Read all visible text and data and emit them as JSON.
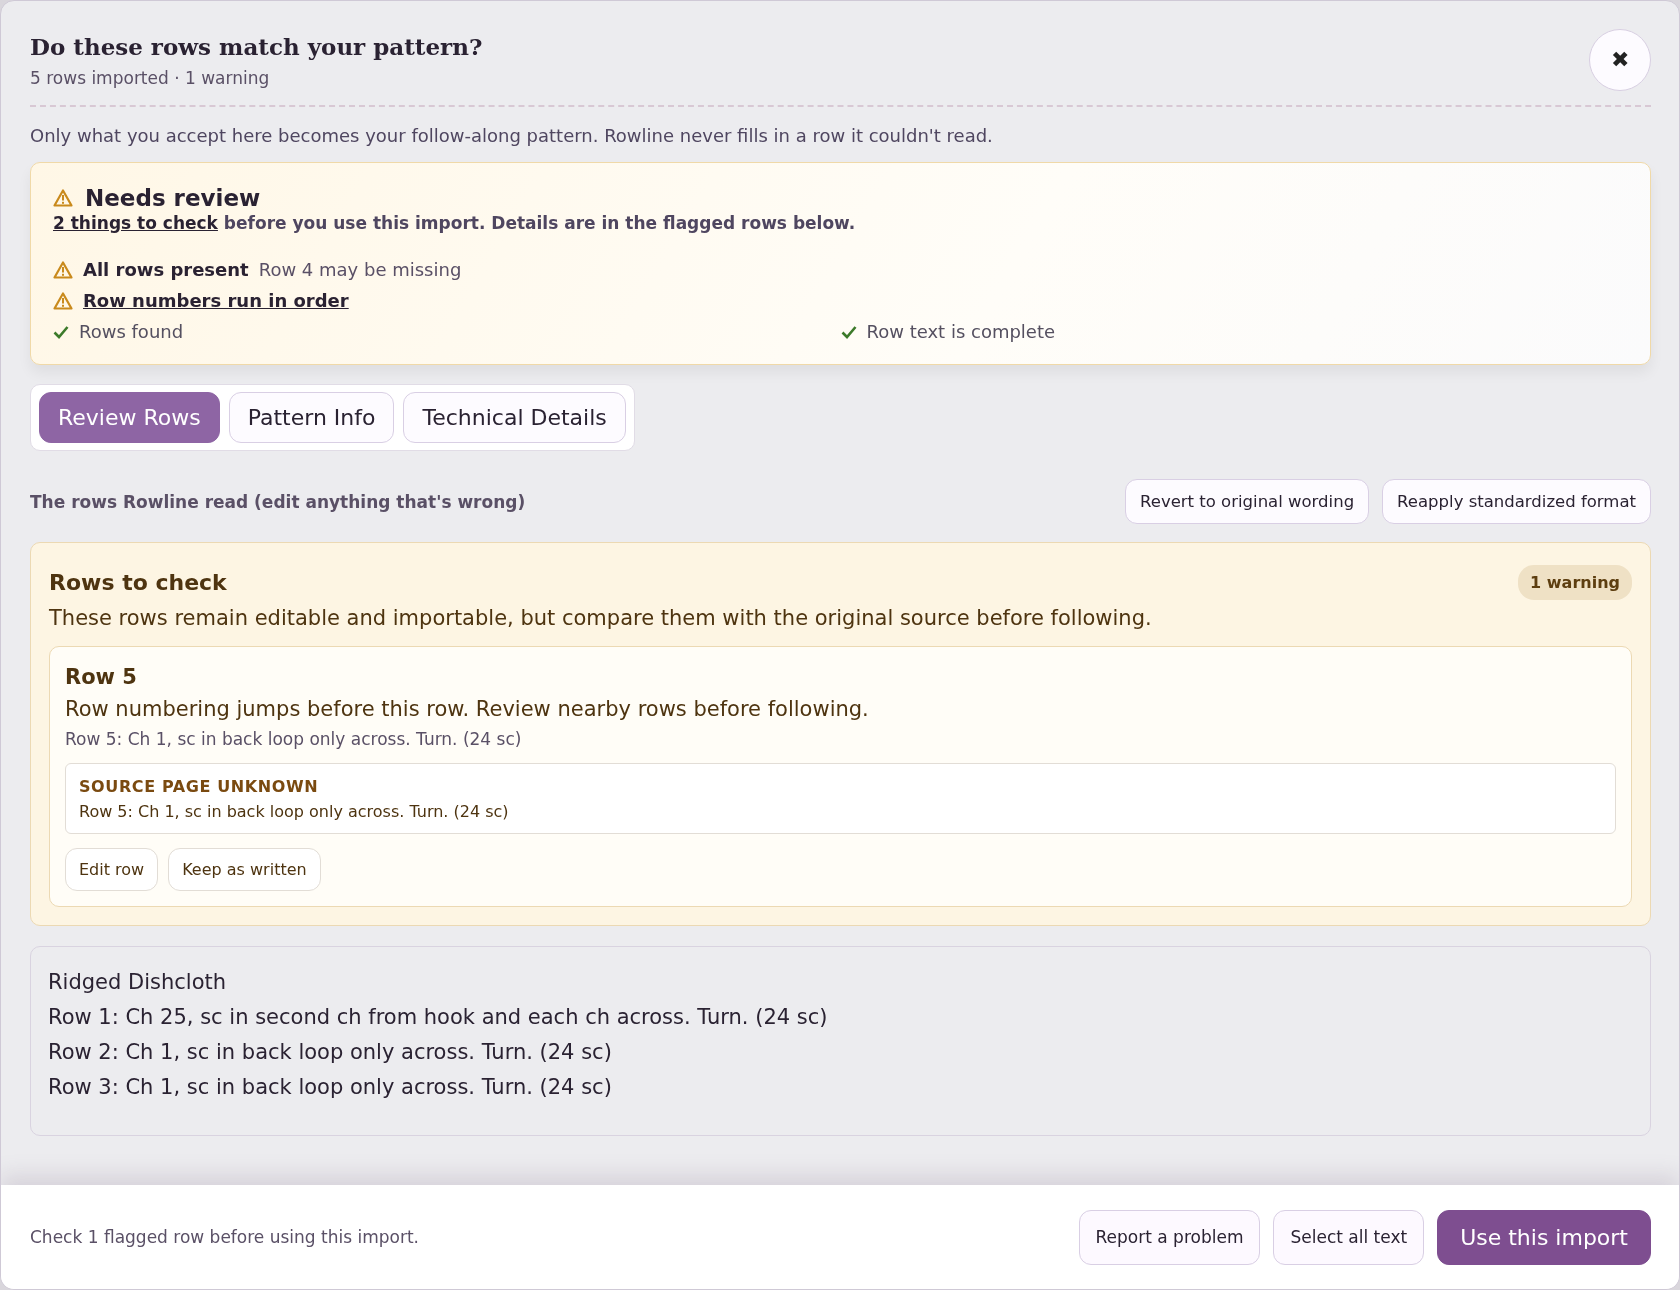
{
  "dialog": {
    "title": "Do these rows match your pattern?",
    "subtitle": "5 rows imported · 1 warning",
    "close_label": "✖",
    "intro": "Only what you accept here becomes your follow-along pattern. Rowline never fills in a row it couldn't read."
  },
  "review": {
    "title": "Needs review",
    "summary_link": "2 things to check",
    "summary_rest": "before you use this import. Details are in the flagged rows below.",
    "checks": [
      {
        "kind": "warning",
        "label": "All rows present",
        "detail": "Row 4 may be missing",
        "link": false
      },
      {
        "kind": "warning",
        "label": "Row numbers run in order",
        "link": true
      },
      {
        "kind": "ok",
        "label": "Rows found",
        "link": false
      },
      {
        "kind": "ok",
        "label": "Row text is complete",
        "link": false
      }
    ]
  },
  "tabs": [
    {
      "label": "Review Rows",
      "selected": true
    },
    {
      "label": "Pattern Info",
      "selected": false
    },
    {
      "label": "Technical Details",
      "selected": false
    }
  ],
  "rows_section": {
    "heading": "The rows Rowline read (edit anything that's wrong)",
    "actions": [
      "Revert to original wording",
      "Reapply standardized format"
    ]
  },
  "flagged": {
    "title": "Rows to check",
    "badge": "1 warning",
    "description": "These rows remain editable and importable, but compare them with the original source before following.",
    "rows": [
      {
        "title": "Row 5",
        "message": "Row numbering jumps before this row. Review nearby rows before following.",
        "text": "Row 5: Ch 1, sc in back loop only across. Turn. (24 sc)",
        "source_label": "SOURCE PAGE UNKNOWN",
        "source_text": "Row 5: Ch 1, sc in back loop only across. Turn. (24 sc)",
        "buttons": [
          "Edit row",
          "Keep as written"
        ]
      }
    ]
  },
  "pattern_text": [
    "Ridged Dishcloth",
    "Row 1: Ch 25, sc in second ch from hook and each ch across. Turn. (24 sc)",
    "Row 2: Ch 1, sc in back loop only across. Turn. (24 sc)",
    "Row 3: Ch 1, sc in back loop only across. Turn. (24 sc)"
  ],
  "footer": {
    "note": "Check 1 flagged row before using this import.",
    "buttons": [
      {
        "label": "Report a problem",
        "kind": "secondary"
      },
      {
        "label": "Select all text",
        "kind": "secondary"
      },
      {
        "label": "Use this import",
        "kind": "primary"
      }
    ]
  }
}
